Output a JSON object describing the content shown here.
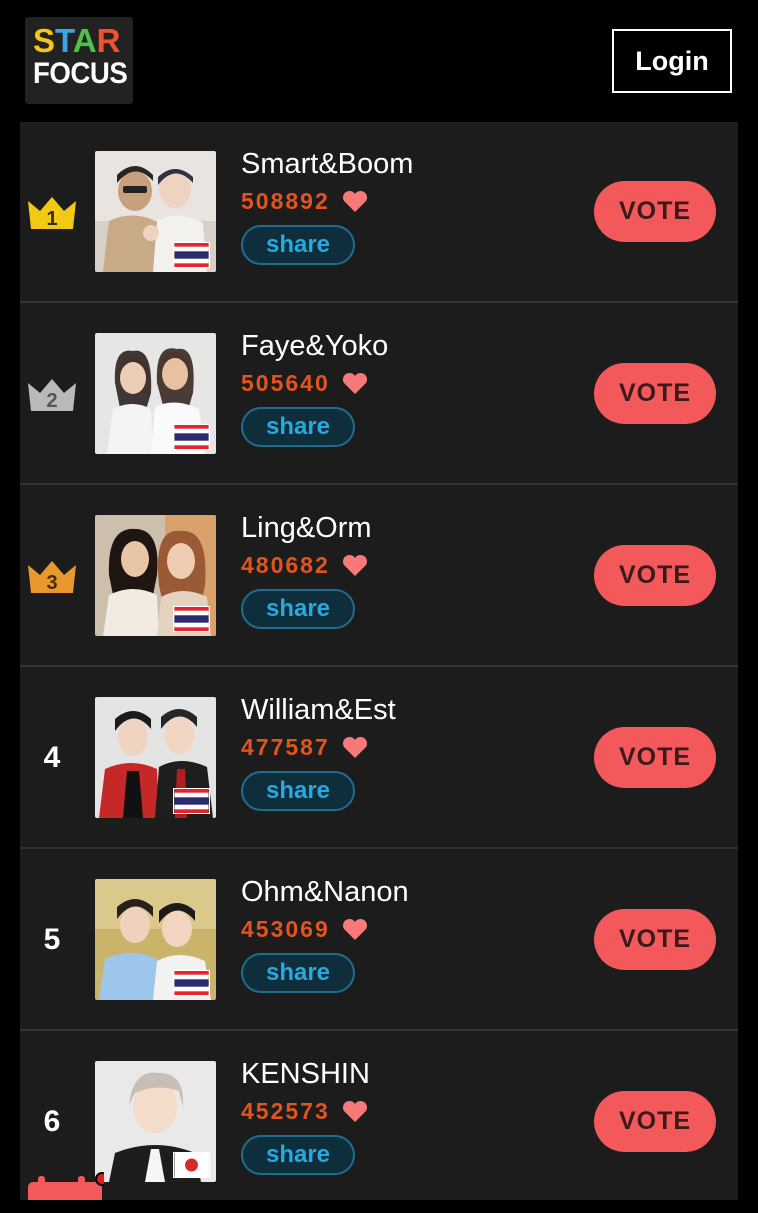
{
  "header": {
    "logo_line1_letters": [
      {
        "char": "S",
        "color": "#f5c518"
      },
      {
        "char": "T",
        "color": "#3aa3e6"
      },
      {
        "char": "A",
        "color": "#4cc24a"
      },
      {
        "char": "R",
        "color": "#f0522d"
      }
    ],
    "logo_line2": "FOCUS",
    "login_label": "Login"
  },
  "colors": {
    "votes": "#e2541e",
    "share_text": "#27a8de",
    "vote_button": "#f3595b",
    "crown_gold": "#f2c914",
    "crown_silver": "#b9b9b9",
    "crown_bronze": "#e8982f"
  },
  "rankings": [
    {
      "rank": "1",
      "name": "Smart&Boom",
      "votes": "508892",
      "share": "share",
      "vote": "VOTE",
      "flag": "thailand",
      "crown": "gold"
    },
    {
      "rank": "2",
      "name": "Faye&Yoko",
      "votes": "505640",
      "share": "share",
      "vote": "VOTE",
      "flag": "thailand",
      "crown": "silver"
    },
    {
      "rank": "3",
      "name": "Ling&Orm",
      "votes": "480682",
      "share": "share",
      "vote": "VOTE",
      "flag": "thailand",
      "crown": "bronze"
    },
    {
      "rank": "4",
      "name": "William&Est",
      "votes": "477587",
      "share": "share",
      "vote": "VOTE",
      "flag": "thailand",
      "crown": ""
    },
    {
      "rank": "5",
      "name": "Ohm&Nanon",
      "votes": "453069",
      "share": "share",
      "vote": "VOTE",
      "flag": "thailand",
      "crown": ""
    },
    {
      "rank": "6",
      "name": "KENSHIN",
      "votes": "452573",
      "share": "share",
      "vote": "VOTE",
      "flag": "japan",
      "crown": ""
    }
  ]
}
